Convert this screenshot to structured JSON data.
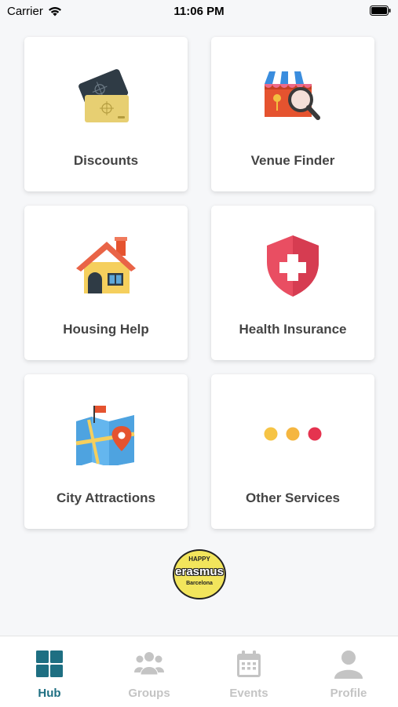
{
  "status_bar": {
    "carrier": "Carrier",
    "time": "11:06 PM"
  },
  "hub": {
    "cards": [
      {
        "label": "Discounts",
        "icon": "discount-cards-icon"
      },
      {
        "label": "Venue Finder",
        "icon": "venue-search-icon"
      },
      {
        "label": "Housing Help",
        "icon": "house-icon"
      },
      {
        "label": "Health Insurance",
        "icon": "shield-cross-icon"
      },
      {
        "label": "City Attractions",
        "icon": "map-pin-icon"
      },
      {
        "label": "Other Services",
        "icon": "more-dots-icon"
      }
    ]
  },
  "logo": {
    "line1": "HAPPY",
    "line2": "erasmus",
    "line3": "Barcelona"
  },
  "tab_bar": {
    "tabs": [
      {
        "label": "Hub",
        "active": true
      },
      {
        "label": "Groups",
        "active": false
      },
      {
        "label": "Events",
        "active": false
      },
      {
        "label": "Profile",
        "active": false
      }
    ]
  },
  "colors": {
    "accent": "#1e6f82",
    "inactive": "#c4c4c4",
    "background": "#f6f7f9"
  }
}
